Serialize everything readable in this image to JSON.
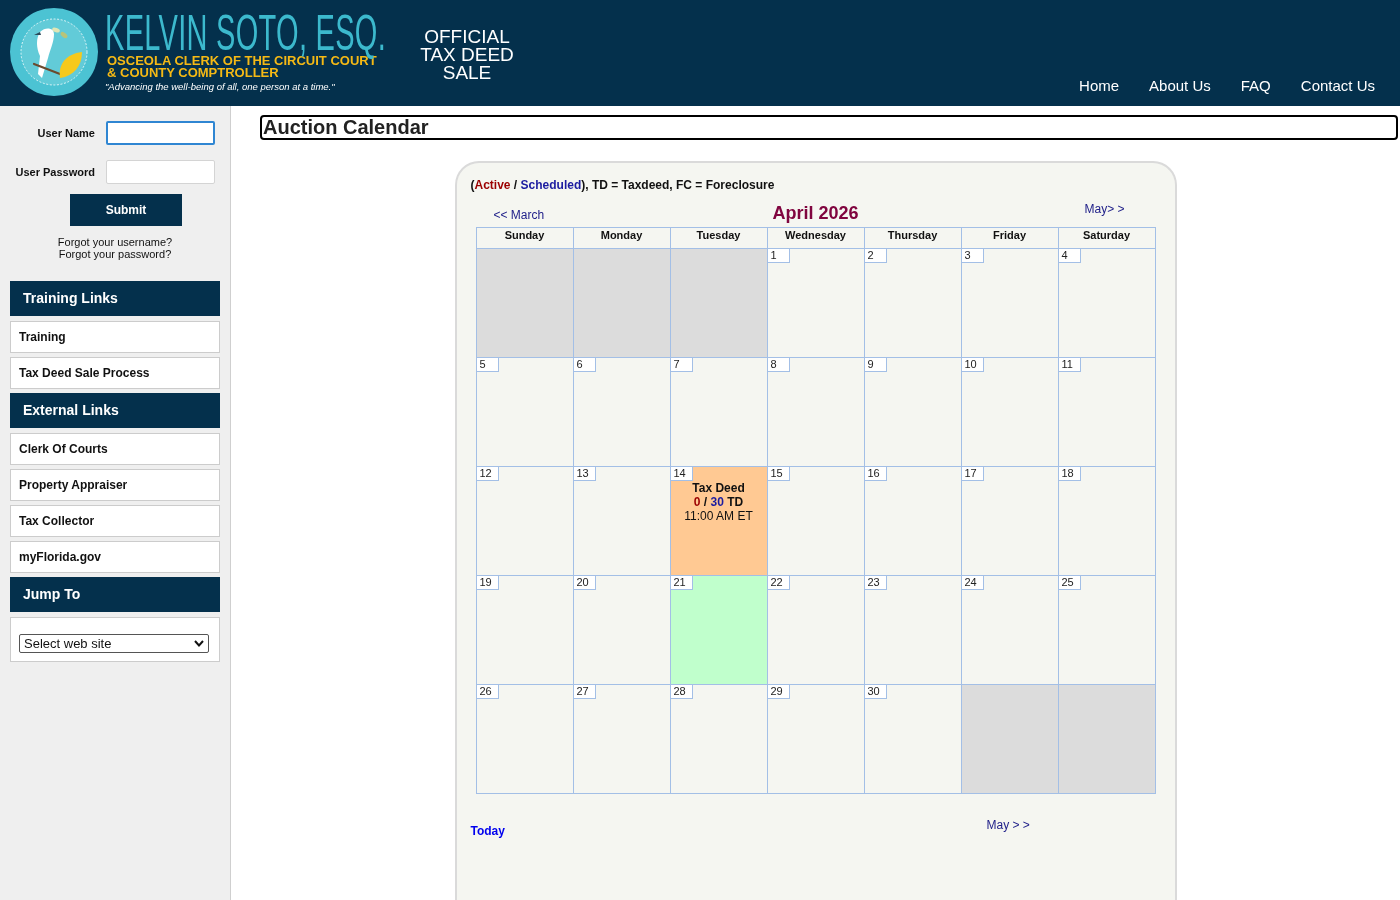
{
  "header": {
    "title": "KELVIN SOTO, ESQ.",
    "subtitle_lines": [
      "OSCEOLA CLERK OF THE CIRCUIT COURT",
      "& COUNTY COMPTROLLER"
    ],
    "tagline": "\"Advancing the well-being of all, one person at a time.\"",
    "sale_title_lines": [
      "OFFICIAL",
      "TAX DEED",
      "SALE"
    ],
    "nav": [
      "Home",
      "About Us",
      "FAQ",
      "Contact Us"
    ]
  },
  "login": {
    "fields": [
      {
        "label": "User Name",
        "focused": true
      },
      {
        "label": "User Password",
        "focused": false
      }
    ],
    "submit": "Submit",
    "links": [
      "Forgot your username?",
      "Forgot your password?"
    ]
  },
  "sidebar": {
    "sections": [
      {
        "title": "Training Links",
        "kind": "links",
        "items": [
          "Training",
          "Tax Deed Sale Process"
        ]
      },
      {
        "title": "External Links",
        "kind": "links",
        "items": [
          "Clerk Of Courts",
          "Property Appraiser",
          "Tax Collector",
          "myFlorida.gov"
        ]
      },
      {
        "title": "Jump To",
        "kind": "select",
        "value": "Select web site"
      }
    ]
  },
  "page_title": "Auction Calendar",
  "calendar": {
    "legend": [
      {
        "text": "(",
        "kind": "plain"
      },
      {
        "text": "Active",
        "kind": "active"
      },
      {
        "text": " / ",
        "kind": "plain"
      },
      {
        "text": "Scheduled",
        "kind": "scheduled"
      },
      {
        "text": "), TD = Taxdeed, FC = Foreclosure",
        "kind": "plain"
      }
    ],
    "prev": "<< March",
    "month": "April 2026",
    "next": "May> >",
    "weekdays": [
      "Sunday",
      "Monday",
      "Tuesday",
      "Wednesday",
      "Thursday",
      "Friday",
      "Saturday"
    ],
    "weeks": [
      [
        {
          "kind": "blank"
        },
        {
          "kind": "blank"
        },
        {
          "kind": "blank"
        },
        {
          "kind": "day",
          "day": "1",
          "today": false
        },
        {
          "kind": "day",
          "day": "2",
          "today": false
        },
        {
          "kind": "day",
          "day": "3",
          "today": false
        },
        {
          "kind": "day",
          "day": "4",
          "today": false
        }
      ],
      [
        {
          "kind": "day",
          "day": "5",
          "today": false
        },
        {
          "kind": "day",
          "day": "6",
          "today": false
        },
        {
          "kind": "day",
          "day": "7",
          "today": false
        },
        {
          "kind": "day",
          "day": "8",
          "today": false
        },
        {
          "kind": "day",
          "day": "9",
          "today": false
        },
        {
          "kind": "day",
          "day": "10",
          "today": false
        },
        {
          "kind": "day",
          "day": "11",
          "today": false
        }
      ],
      [
        {
          "kind": "day",
          "day": "12",
          "today": false
        },
        {
          "kind": "day",
          "day": "13",
          "today": false
        },
        {
          "kind": "day",
          "day": "14",
          "today": false,
          "event": {
            "title": "Tax Deed",
            "counts": [
              {
                "text": "0",
                "kind": "active"
              },
              {
                "text": " / ",
                "kind": "plain"
              },
              {
                "text": "30",
                "kind": "scheduled"
              },
              {
                "text": " TD",
                "kind": "plain"
              }
            ],
            "time": "11:00 AM ET"
          }
        },
        {
          "kind": "day",
          "day": "15",
          "today": false
        },
        {
          "kind": "day",
          "day": "16",
          "today": false
        },
        {
          "kind": "day",
          "day": "17",
          "today": false
        },
        {
          "kind": "day",
          "day": "18",
          "today": false
        }
      ],
      [
        {
          "kind": "day",
          "day": "19",
          "today": false
        },
        {
          "kind": "day",
          "day": "20",
          "today": false
        },
        {
          "kind": "day",
          "day": "21",
          "today": true
        },
        {
          "kind": "day",
          "day": "22",
          "today": false
        },
        {
          "kind": "day",
          "day": "23",
          "today": false
        },
        {
          "kind": "day",
          "day": "24",
          "today": false
        },
        {
          "kind": "day",
          "day": "25",
          "today": false
        }
      ],
      [
        {
          "kind": "day",
          "day": "26",
          "today": false
        },
        {
          "kind": "day",
          "day": "27",
          "today": false
        },
        {
          "kind": "day",
          "day": "28",
          "today": false
        },
        {
          "kind": "day",
          "day": "29",
          "today": false
        },
        {
          "kind": "day",
          "day": "30",
          "today": false
        },
        {
          "kind": "blank"
        },
        {
          "kind": "blank"
        }
      ]
    ],
    "footer": {
      "today": "Today",
      "next": "May > >"
    }
  }
}
